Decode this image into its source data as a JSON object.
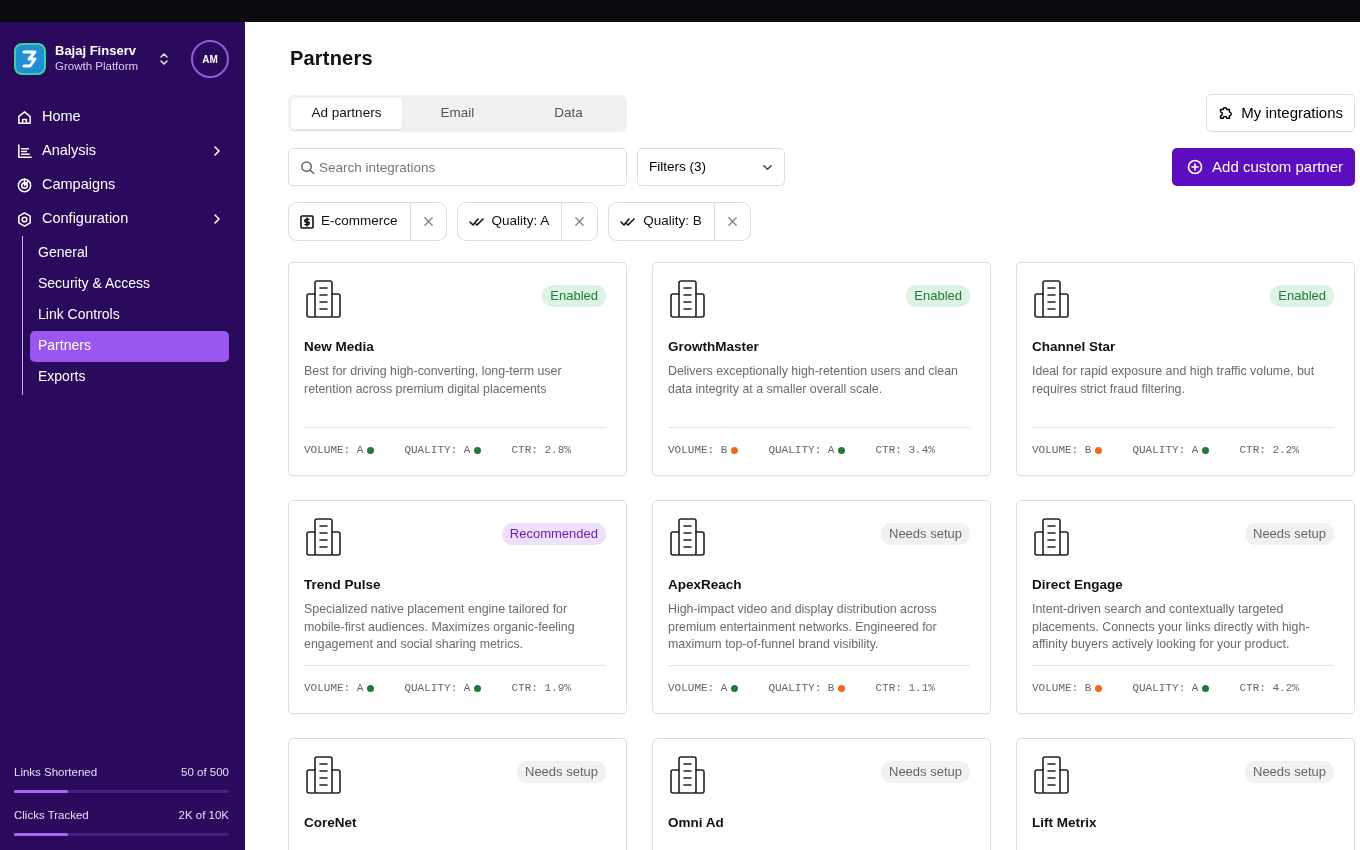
{
  "brand": {
    "name": "Bajaj Finserv",
    "subtitle": "Growth Platform",
    "avatar": "AM"
  },
  "nav": [
    {
      "label": "Home",
      "kind": "link",
      "selected": false
    },
    {
      "label": "Analysis",
      "kind": "group",
      "selected": false
    },
    {
      "label": "Campaigns",
      "kind": "link",
      "selected": false
    },
    {
      "label": "Configuration",
      "kind": "group",
      "selected": false,
      "children": [
        {
          "label": "General",
          "selected": false
        },
        {
          "label": "Security & Access",
          "selected": false
        },
        {
          "label": "Link Controls",
          "selected": false
        },
        {
          "label": "Partners",
          "selected": true
        },
        {
          "label": "Exports",
          "selected": false
        }
      ]
    }
  ],
  "usage": [
    {
      "label": "Links Shortened",
      "reading": "50 of 500",
      "level": 0.25
    },
    {
      "label": "Clicks Tracked",
      "reading": "2K of 10K",
      "level": 0.25
    }
  ],
  "page_title": "Partners",
  "tabs": [
    {
      "label": "Ad partners",
      "selected": true
    },
    {
      "label": "Email",
      "selected": false
    },
    {
      "label": "Data",
      "selected": false
    }
  ],
  "my_integrations": "My integrations",
  "search": {
    "placeholder": "Search integrations"
  },
  "filters": "Filters (3)",
  "add_button": "Add custom partner",
  "chips": [
    {
      "label": "E-commerce",
      "kind": "category"
    },
    {
      "label": "Quality: A",
      "kind": "quality"
    },
    {
      "label": "Quality: B",
      "kind": "quality"
    }
  ],
  "cards": [
    {
      "name": "New Media",
      "status": "Enabled",
      "kind": "enabled",
      "description": "Best for driving high-converting, long-term user retention across premium digital placements",
      "metrics": [
        {
          "label": "VOLUME: A",
          "color": "#1e7b3c"
        },
        {
          "label": "QUALITY: A",
          "color": "#1e7b3c"
        },
        {
          "label": "CTR: 2.8%"
        }
      ]
    },
    {
      "name": "GrowthMaster",
      "status": "Enabled",
      "kind": "enabled",
      "description": "Delivers exceptionally high-retention users and clean data integrity at a smaller overall scale.",
      "metrics": [
        {
          "label": "VOLUME: B",
          "color": "#f06a1a"
        },
        {
          "label": "QUALITY: A",
          "color": "#1e7b3c"
        },
        {
          "label": "CTR: 3.4%"
        }
      ]
    },
    {
      "name": "Channel Star",
      "status": "Enabled",
      "kind": "enabled",
      "description": "Ideal for rapid exposure and high traffic volume, but requires strict fraud filtering.",
      "metrics": [
        {
          "label": "VOLUME: B",
          "color": "#f06a1a"
        },
        {
          "label": "QUALITY: A",
          "color": "#1e7b3c"
        },
        {
          "label": "CTR: 2.2%"
        }
      ]
    },
    {
      "name": "Trend Pulse",
      "status": "Recommended",
      "kind": "recommended",
      "description": "Specialized native placement engine tailored for mobile-first audiences. Maximizes organic-feeling engagement and social sharing metrics.",
      "metrics": [
        {
          "label": "VOLUME: A",
          "color": "#1e7b3c"
        },
        {
          "label": "QUALITY: A",
          "color": "#1e7b3c"
        },
        {
          "label": "CTR: 1.9%"
        }
      ]
    },
    {
      "name": "ApexReach",
      "status": "Needs setup",
      "kind": "setup",
      "description": "High-impact video and display distribution across premium entertainment networks. Engineered for maximum top-of-funnel brand visibility.",
      "metrics": [
        {
          "label": "VOLUME: A",
          "color": "#1e7b3c"
        },
        {
          "label": "QUALITY: B",
          "color": "#f06a1a"
        },
        {
          "label": "CTR: 1.1%"
        }
      ]
    },
    {
      "name": "Direct Engage",
      "status": "Needs setup",
      "kind": "setup",
      "description": "Intent-driven search and contextually targeted placements. Connects your links directly with high-affinity buyers actively looking for your product.",
      "metrics": [
        {
          "label": "VOLUME: B",
          "color": "#f06a1a"
        },
        {
          "label": "QUALITY: A",
          "color": "#1e7b3c"
        },
        {
          "label": "CTR: 4.2%"
        }
      ]
    },
    {
      "name": "CoreNet",
      "status": "Needs setup",
      "kind": "setup"
    },
    {
      "name": "Omni Ad",
      "status": "Needs setup",
      "kind": "setup"
    },
    {
      "name": "Lift Metrix",
      "status": "Needs setup",
      "kind": "setup"
    }
  ]
}
